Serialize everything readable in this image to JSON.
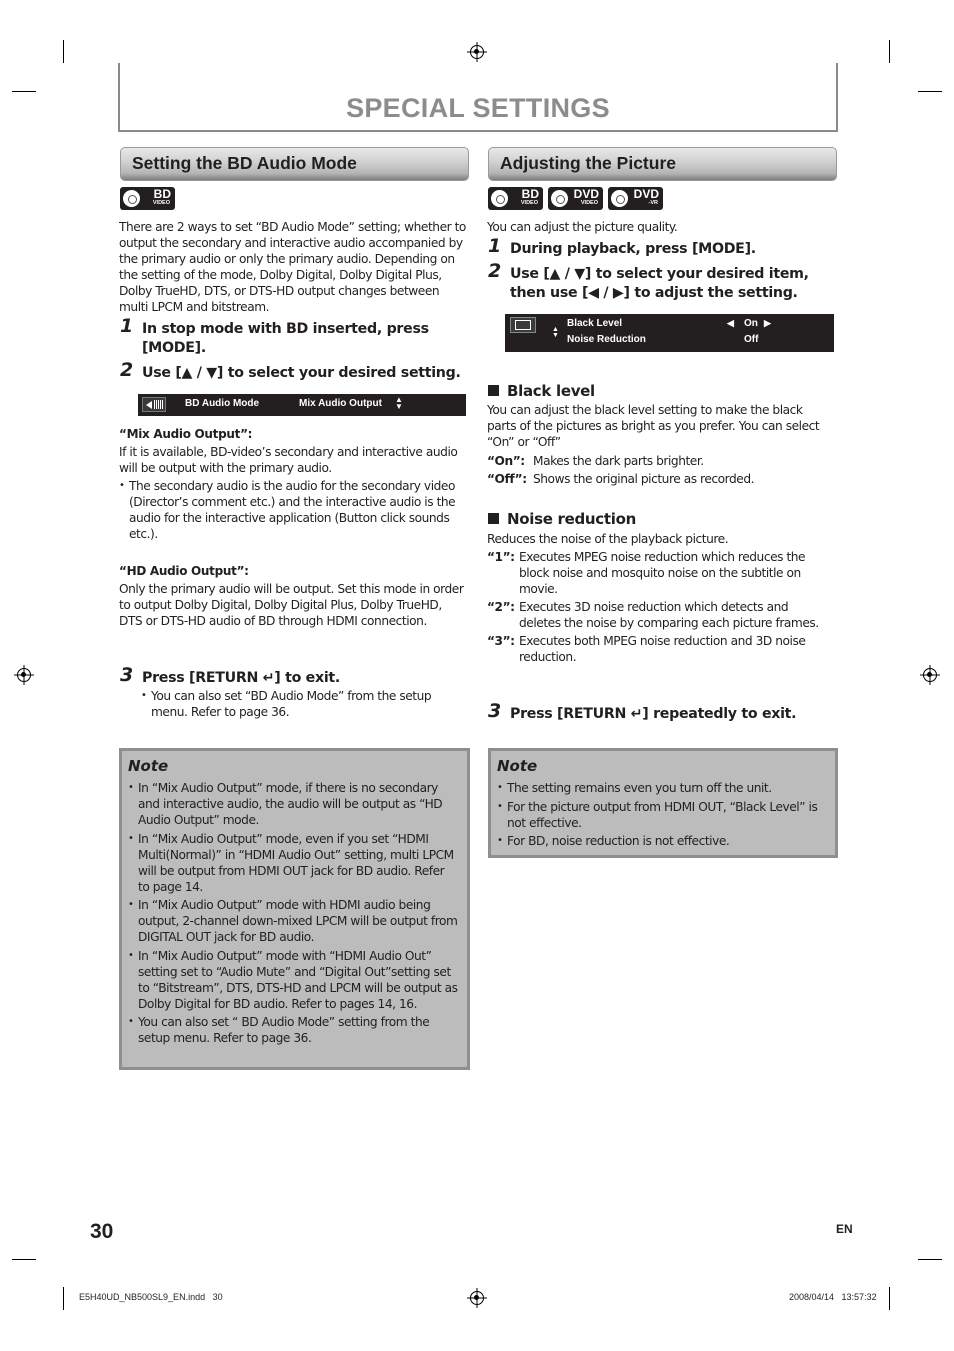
{
  "page": {
    "title": "SPECIAL SETTINGS",
    "page_number": "30",
    "language": "EN",
    "file_info": "E5H40UD_NB500SL9_EN.indd   30",
    "timestamp": "2008/04/14   13:57:32"
  },
  "left": {
    "heading": "Setting the BD Audio Mode",
    "badges": [
      {
        "icon": "bd-video-disc-icon",
        "line1": "BD",
        "line2": "VIDEO"
      }
    ],
    "intro": "There are 2 ways to set “BD Audio Mode” setting; whether to output the secondary and interactive audio accompanied by the primary audio or only the primary audio. Depending on the setting of the mode, Dolby Digital, Dolby Digital Plus, Dolby TrueHD, DTS, or DTS-HD output changes between multi LPCM and bitstream.",
    "steps": [
      {
        "num": "1",
        "text": "In stop mode with BD inserted, press [MODE]."
      },
      {
        "num": "2",
        "text": "Use [▲ / ▼] to select your desired setting."
      },
      {
        "num": "3",
        "text": "Press [RETURN ↵] to exit."
      }
    ],
    "osd": {
      "icon": "speaker-icon",
      "label": "BD Audio Mode",
      "value": "Mix Audio Output",
      "arrows": "up-down-arrows-icon"
    },
    "mix_heading": "“Mix Audio Output”:",
    "mix_text": "If it is available, BD-video’s secondary and interactive audio will be output with the primary audio.",
    "mix_bullet": "The secondary audio is the audio for the secondary video (Director’s comment etc.) and the interactive audio is the audio for the interactive application (Button click sounds etc.).",
    "hd_heading": "“HD Audio Output”:",
    "hd_text": "Only the primary audio will be output. Set this mode in order to output Dolby Digital, Dolby Digital Plus, Dolby TrueHD, DTS or DTS-HD audio of BD through HDMI connection.",
    "step3_bullet": "You can also set “BD Audio Mode” from the setup menu. Refer to page 36.",
    "note": {
      "title": "Note",
      "items": [
        "In “Mix Audio Output” mode, if there is no secondary and interactive audio, the audio will be output as “HD Audio Output” mode.",
        "In “Mix Audio Output” mode, even if you set “HDMI Multi(Normal)” in “HDMI Audio Out” setting, multi LPCM will be output from HDMI OUT jack for BD audio. Refer to page 14.",
        "In “Mix Audio Output” mode with HDMI audio being output, 2-channel down-mixed LPCM will be output from DIGITAL OUT jack for BD audio.",
        "In “Mix Audio Output” mode with “HDMI Audio Out” setting set to “Audio Mute” and  “Digital Out”setting set to “Bitstream”, DTS, DTS-HD and LPCM will be output as Dolby Digital for BD audio. Refer to pages 14, 16.",
        "You can also set “ BD Audio Mode” setting from the setup menu. Refer to page 36."
      ]
    }
  },
  "right": {
    "heading": "Adjusting the Picture",
    "badges": [
      {
        "icon": "bd-video-disc-icon",
        "line1": "BD",
        "line2": "VIDEO"
      },
      {
        "icon": "dvd-video-disc-icon",
        "line1": "DVD",
        "line2": "VIDEO"
      },
      {
        "icon": "dvd-vr-disc-icon",
        "line1": "DVD",
        "line2": "-VR"
      }
    ],
    "intro": "You can adjust the picture quality.",
    "steps": [
      {
        "num": "1",
        "text": "During playback, press [MODE]."
      },
      {
        "num": "2",
        "text": "Use [▲ / ▼] to select your desired item, then use [◀ / ▶] to adjust the setting."
      },
      {
        "num": "3",
        "text": "Press [RETURN ↵] repeatedly to exit."
      }
    ],
    "osd": {
      "icon": "picture-settings-icon",
      "rows": [
        {
          "label": "Black Level",
          "value": "On",
          "selected": true
        },
        {
          "label": "Noise Reduction",
          "value": "Off",
          "selected": false
        }
      ]
    },
    "black_level": {
      "heading": "Black level",
      "text": "You can adjust the black level setting to make the black parts of the pictures as bright as you prefer. You can select “On” or “Off”",
      "options": [
        {
          "key": "“On”:",
          "desc": "Makes the dark parts brighter."
        },
        {
          "key": "“Off”:",
          "desc": "Shows the original picture as recorded."
        }
      ]
    },
    "noise_reduction": {
      "heading": "Noise reduction",
      "text": "Reduces the noise of the playback picture.",
      "options": [
        {
          "key": "“1”:",
          "desc": "Executes MPEG noise reduction which reduces the block noise and mosquito noise on the subtitle on movie."
        },
        {
          "key": "“2”:",
          "desc": "Executes 3D noise reduction which detects and deletes the noise by comparing each picture frames."
        },
        {
          "key": "“3”:",
          "desc": "Executes both MPEG noise reduction and 3D noise reduction."
        }
      ]
    },
    "note": {
      "title": "Note",
      "items": [
        "The setting remains even you turn off the unit.",
        "For the picture output from HDMI OUT, “Black Level” is not effective.",
        "For BD, noise reduction is not effective."
      ]
    }
  }
}
